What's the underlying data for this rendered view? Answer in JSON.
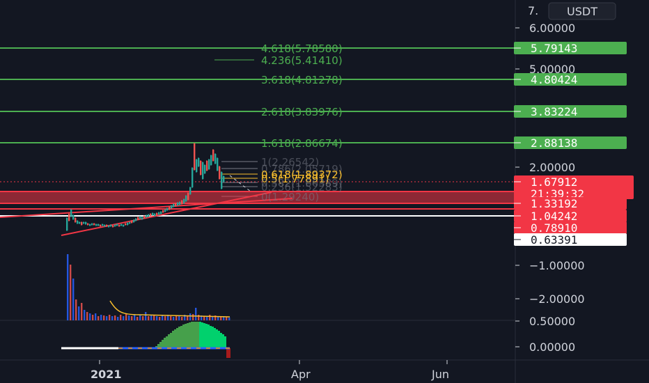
{
  "header": {
    "currency": "USDT",
    "top_tick_partial": "7."
  },
  "colors": {
    "background": "#131722",
    "green": "#4caf50",
    "red": "#f23645",
    "grid": "#2a2e39",
    "white": "#ffffff",
    "yellow": "#fbc02d",
    "orange": "#ff9800"
  },
  "chart_data": {
    "type": "line",
    "title": "",
    "y_axis_ticks": [
      {
        "label": "6.00000",
        "value": 6.0
      },
      {
        "label": "5.00000",
        "value": 5.0
      },
      {
        "label": "2.00000",
        "value": 2.0
      },
      {
        "label": "−1.00000",
        "value": -1.0
      },
      {
        "label": "−2.00000",
        "value": -2.0
      },
      {
        "label": "0.50000",
        "value": 0.5
      },
      {
        "label": "0.00000",
        "value": 0.0
      }
    ],
    "x_axis_ticks": [
      "2021",
      "Apr",
      "Jun"
    ],
    "fib_levels": [
      {
        "ratio": "4.618",
        "value": "5.78580",
        "badge": "5.79143"
      },
      {
        "ratio": "4.236",
        "value": "5.41410",
        "badge": ""
      },
      {
        "ratio": "3.618",
        "value": "4.81278",
        "badge": "4.80424"
      },
      {
        "ratio": "2.618",
        "value": "3.83976",
        "badge": "3.83224"
      },
      {
        "ratio": "1.618",
        "value": "2.86674",
        "badge": "2.88138"
      },
      {
        "ratio": "1",
        "value": "2.26542",
        "badge": ""
      },
      {
        "ratio": "0.786",
        "value": "2.05719",
        "badge": ""
      },
      {
        "ratio": "0.618",
        "value": "1.89372",
        "badge": ""
      },
      {
        "ratio": "0.5",
        "value": "1.77891",
        "badge": ""
      },
      {
        "ratio": "0.382",
        "value": "1.66389",
        "badge": ""
      },
      {
        "ratio": "0.236",
        "value": "1.52283",
        "badge": ""
      },
      {
        "ratio": "0",
        "value": "1.29240",
        "badge": ""
      }
    ],
    "price_badges": [
      {
        "label": "5.79143",
        "kind": "green"
      },
      {
        "label": "4.80424",
        "kind": "green"
      },
      {
        "label": "3.83224",
        "kind": "green"
      },
      {
        "label": "2.88138",
        "kind": "green"
      },
      {
        "label": "1.67912",
        "kind": "red",
        "sub": "21:39:32"
      },
      {
        "label": "1.33192",
        "kind": "red"
      },
      {
        "label": "1.04242",
        "kind": "red"
      },
      {
        "label": "0.78910",
        "kind": "red"
      },
      {
        "label": "0.63391",
        "kind": "white"
      }
    ],
    "grid": false,
    "legend": "none"
  }
}
